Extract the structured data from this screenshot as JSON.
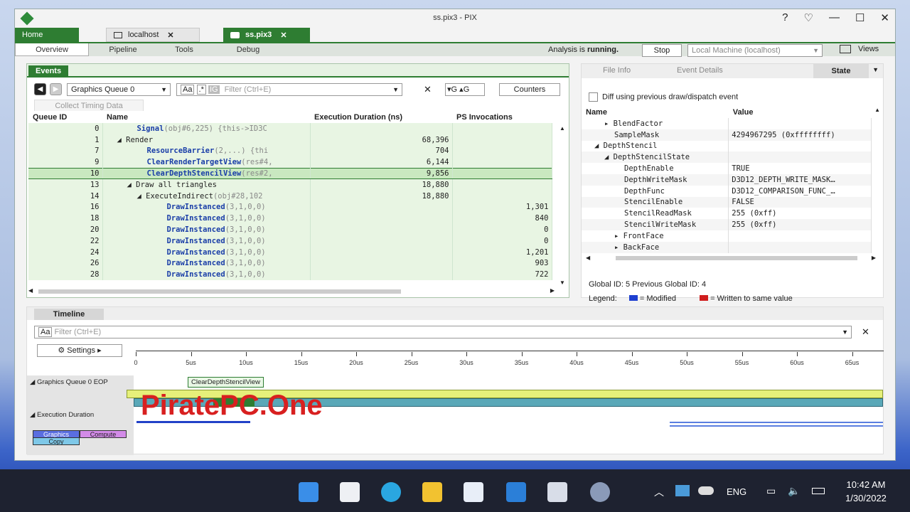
{
  "window": {
    "title": "ss.pix3 - PIX",
    "help": "?",
    "feedback": "♡",
    "minimize": "—",
    "maximize": "☐",
    "close": "✕"
  },
  "tabs": {
    "home": "Home",
    "localhost": "localhost",
    "ss": "ss.pix3"
  },
  "subtabs": [
    "Overview",
    "Pipeline",
    "Tools",
    "Debug"
  ],
  "status": {
    "label": "Analysis is",
    "state": "running.",
    "stop": "Stop",
    "machine": "Local Machine (localhost)",
    "views": "Views"
  },
  "events": {
    "tab": "Events",
    "queue": "Graphics Queue 0",
    "case_label": "Aa",
    "regex_label": ".*",
    "ig_label": "IG",
    "filter_placeholder": "Filter (Ctrl+E)",
    "prev_g": "G",
    "next_g": "G",
    "counters": "Counters",
    "collect": "Collect Timing Data",
    "columns": [
      "Queue ID",
      "Name",
      "Execution Duration (ns)",
      "PS Invocations"
    ],
    "rows": [
      {
        "id": "0",
        "name": "Signal",
        "args": "(obj#6,225)  {this->ID3C",
        "dur": "",
        "ps": "",
        "indent": 3
      },
      {
        "id": "1",
        "name": "◢ Render",
        "args": "",
        "dur": "68,396",
        "ps": "",
        "indent": 1
      },
      {
        "id": "7",
        "name": "ResourceBarrier",
        "args": "(2,...)  {thi",
        "dur": "704",
        "ps": "",
        "indent": 4
      },
      {
        "id": "9",
        "name": "ClearRenderTargetView",
        "args": "(res#4,",
        "dur": "6,144",
        "ps": "",
        "indent": 4
      },
      {
        "id": "10",
        "name": "ClearDepthStencilView",
        "args": "(res#2,",
        "dur": "9,856",
        "ps": "",
        "indent": 4
      },
      {
        "id": "13",
        "name": "◢ Draw all triangles",
        "args": "",
        "dur": "18,880",
        "ps": "",
        "indent": 2
      },
      {
        "id": "14",
        "name": "◢ ExecuteIndirect",
        "args": "(obj#28,102",
        "dur": "18,880",
        "ps": "",
        "indent": 3
      },
      {
        "id": "16",
        "name": "DrawInstanced",
        "args": "(3,1,0,0)",
        "dur": "",
        "ps": "1,301",
        "indent": 6
      },
      {
        "id": "18",
        "name": "DrawInstanced",
        "args": "(3,1,0,0)",
        "dur": "",
        "ps": "840",
        "indent": 6
      },
      {
        "id": "20",
        "name": "DrawInstanced",
        "args": "(3,1,0,0)",
        "dur": "",
        "ps": "0",
        "indent": 6
      },
      {
        "id": "22",
        "name": "DrawInstanced",
        "args": "(3,1,0,0)",
        "dur": "",
        "ps": "0",
        "indent": 6
      },
      {
        "id": "24",
        "name": "DrawInstanced",
        "args": "(3,1,0,0)",
        "dur": "",
        "ps": "1,201",
        "indent": 6
      },
      {
        "id": "26",
        "name": "DrawInstanced",
        "args": "(3,1,0,0)",
        "dur": "",
        "ps": "903",
        "indent": 6
      },
      {
        "id": "28",
        "name": "DrawInstanced",
        "args": "(3,1,0,0)",
        "dur": "",
        "ps": "722",
        "indent": 6
      }
    ]
  },
  "right": {
    "tabs": [
      "File Info",
      "Event Details",
      "State"
    ],
    "diff": "Diff using previous draw/dispatch event",
    "columns": [
      "Name",
      "Value"
    ],
    "rows": [
      {
        "name": "▸ BlendFactor",
        "value": "",
        "indent": 2
      },
      {
        "name": "SampleMask",
        "value": "4294967295 (0xffffffff)",
        "indent": 3
      },
      {
        "name": "◢ DepthStencil",
        "value": "",
        "indent": 1
      },
      {
        "name": "◢ DepthStencilState",
        "value": "",
        "indent": 2
      },
      {
        "name": "DepthEnable",
        "value": "TRUE",
        "indent": 4
      },
      {
        "name": "DepthWriteMask",
        "value": "D3D12_DEPTH_WRITE_MASK…",
        "indent": 4
      },
      {
        "name": "DepthFunc",
        "value": "D3D12_COMPARISON_FUNC_…",
        "indent": 4
      },
      {
        "name": "StencilEnable",
        "value": "FALSE",
        "indent": 4
      },
      {
        "name": "StencilReadMask",
        "value": "255 (0xff)",
        "indent": 4
      },
      {
        "name": "StencilWriteMask",
        "value": "255 (0xff)",
        "indent": 4
      },
      {
        "name": "▸ FrontFace",
        "value": "",
        "indent": 3
      },
      {
        "name": "▸ BackFace",
        "value": "",
        "indent": 3
      }
    ],
    "global": "Global ID: 5  Previous Global ID: 4",
    "legend_label": "Legend:",
    "legend_modified": "= Modified",
    "legend_written": "= Written to same value",
    "modified_color": "#1e3fd0",
    "written_color": "#d01e1e"
  },
  "timeline": {
    "tab": "Timeline",
    "case_label": "Aa",
    "filter_placeholder": "Filter (Ctrl+E)",
    "settings": "Settings",
    "ticks": [
      "0",
      "5us",
      "10us",
      "15us",
      "20us",
      "25us",
      "30us",
      "35us",
      "40us",
      "45us",
      "50us",
      "55us",
      "60us",
      "65us"
    ],
    "tooltip": "ClearDepthStencilView",
    "lane1": "Graphics Queue 0 EOP",
    "lane2": "Execution Duration",
    "legend": {
      "graphics": "Graphics",
      "compute": "Compute",
      "copy": "Copy"
    }
  },
  "watermark": "PiratePC.One",
  "taskbar": {
    "lang": "ENG",
    "time": "10:42 AM",
    "date": "1/30/2022"
  }
}
